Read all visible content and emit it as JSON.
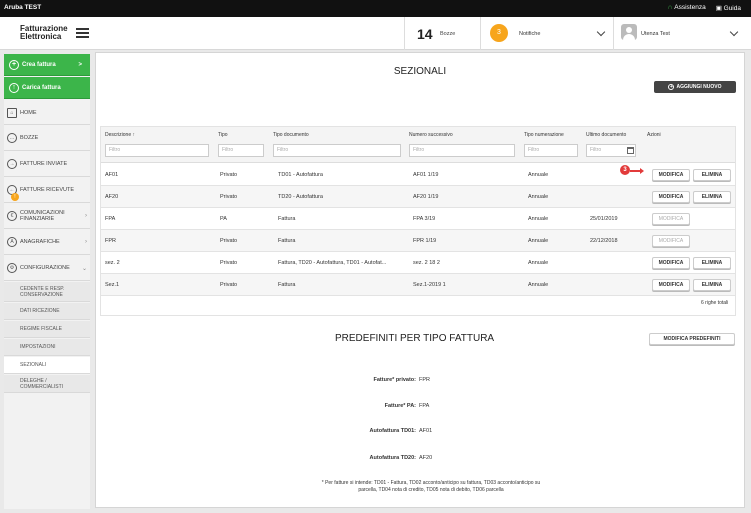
{
  "topbar": {
    "brand": "Aruba TEST",
    "assistenza": "Assistenza",
    "guida": "Guida"
  },
  "header": {
    "logo_line1": "Fatturazione",
    "logo_line2": "Elettronica",
    "bozze_count": "14",
    "bozze_label": "Bozze",
    "notif_count": "3",
    "notif_label": "Notifiche",
    "user_label": "Utenza Test"
  },
  "sidebar": {
    "crea": "Crea fattura",
    "carica": "Carica fattura",
    "items": [
      {
        "label": "HOME",
        "icon": "home-icon"
      },
      {
        "label": "BOZZE",
        "icon": "drafts-icon"
      },
      {
        "label": "FATTURE INVIATE",
        "icon": "sent-icon"
      },
      {
        "label": "FATTURE RICEVUTE",
        "icon": "received-icon",
        "badge": "!"
      },
      {
        "label1": "COMUNICAZIONI",
        "label2": "FINANZIARIE",
        "icon": "finance-icon"
      },
      {
        "label": "ANAGRAFICHE",
        "icon": "registry-icon"
      },
      {
        "label": "CONFIGURAZIONE",
        "icon": "settings-icon"
      }
    ],
    "sub": [
      {
        "l1": "CEDENTE E RESP.",
        "l2": "CONSERVAZIONE"
      },
      {
        "l1": "DATI RICEZIONE",
        "l2": ""
      },
      {
        "l1": "REGIME FISCALE",
        "l2": ""
      },
      {
        "l1": "IMPOSTAZIONI",
        "l2": ""
      },
      {
        "l1": "SEZIONALI",
        "l2": ""
      },
      {
        "l1": "DELEGHE /",
        "l2": "COMMERCIALISTI"
      }
    ]
  },
  "main": {
    "title": "SEZIONALI",
    "add_button": "AGGIUNGI NUOVO",
    "columns": [
      "Descrizione ↑",
      "Tipo",
      "Tipo documento",
      "Numero successivo",
      "Tipo numerazione",
      "Ultimo documento",
      "Azioni"
    ],
    "filter_placeholder": "Filtro",
    "rows": [
      {
        "desc": "AF01",
        "tipo": "Privato",
        "tipodoc": "TD01 - Autofattura",
        "num": "AF01 1/19",
        "numeraz": "Annuale",
        "ultimo": "",
        "edit": "MODIFICA",
        "del": "ELIMINA",
        "edit_enabled": true
      },
      {
        "desc": "AF20",
        "tipo": "Privato",
        "tipodoc": "TD20 - Autofattura",
        "num": "AF20 1/19",
        "numeraz": "Annuale",
        "ultimo": "",
        "edit": "MODIFICA",
        "del": "ELIMINA",
        "edit_enabled": true
      },
      {
        "desc": "FPA",
        "tipo": "PA",
        "tipodoc": "Fattura",
        "num": "FPA 3/19",
        "numeraz": "Annuale",
        "ultimo": "25/01/2019",
        "edit": "MODIFICA",
        "del": "",
        "edit_enabled": false
      },
      {
        "desc": "FPR",
        "tipo": "Privato",
        "tipodoc": "Fattura",
        "num": "FPR 1/19",
        "numeraz": "Annuale",
        "ultimo": "22/12/2018",
        "edit": "MODIFICA",
        "del": "",
        "edit_enabled": false
      },
      {
        "desc": "sez. 2",
        "tipo": "Privato",
        "tipodoc": "Fattura, TD20 - Autofattura, TD01 - Autofat...",
        "num": "sez. 2 18 2",
        "numeraz": "Annuale",
        "ultimo": "",
        "edit": "MODIFICA",
        "del": "ELIMINA",
        "edit_enabled": true
      },
      {
        "desc": "Sez.1",
        "tipo": "Privato",
        "tipodoc": "Fattura",
        "num": "Sez.1-2019 1",
        "numeraz": "Annuale",
        "ultimo": "",
        "edit": "MODIFICA",
        "del": "ELIMINA",
        "edit_enabled": true
      }
    ],
    "rows_total": "6 righe totali",
    "step_marker": "3"
  },
  "predefiniti": {
    "title": "PREDEFINITI PER TIPO FATTURA",
    "button": "MODIFICA PREDEFINITI",
    "items": [
      {
        "label": "Fatture* privato:",
        "value": "FPR"
      },
      {
        "label": "Fatture* PA:",
        "value": "FPA"
      },
      {
        "label": "Autofattura TD01:",
        "value": "AF01"
      },
      {
        "label": "Autofattura TD20:",
        "value": "AF20"
      }
    ],
    "footnote_1": "* Per fatture si intende: TD01 - Fattura, TD02 acconto/anticipo su fattura, TD03 acconto/anticipo su",
    "footnote_2": "parcella, TD04 nota di credito, TD05 nota di debito, TD06 parcella"
  }
}
